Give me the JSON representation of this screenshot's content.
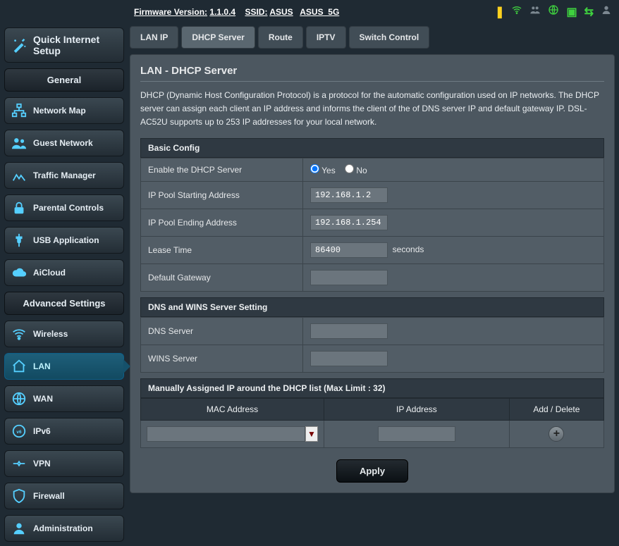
{
  "header": {
    "firmware_label": "Firmware Version:",
    "firmware_value": "1.1.0.4",
    "ssid_label": "SSID:",
    "ssid1": "ASUS",
    "ssid2": "ASUS_5G"
  },
  "sidebar": {
    "quick": "Quick Internet Setup",
    "general_header": "General",
    "general": [
      {
        "label": "Network Map"
      },
      {
        "label": "Guest Network"
      },
      {
        "label": "Traffic Manager"
      },
      {
        "label": "Parental Controls"
      },
      {
        "label": "USB Application"
      },
      {
        "label": "AiCloud"
      }
    ],
    "advanced_header": "Advanced Settings",
    "advanced": [
      {
        "label": "Wireless"
      },
      {
        "label": "LAN"
      },
      {
        "label": "WAN"
      },
      {
        "label": "IPv6"
      },
      {
        "label": "VPN"
      },
      {
        "label": "Firewall"
      },
      {
        "label": "Administration"
      }
    ]
  },
  "tabs": [
    "LAN IP",
    "DHCP Server",
    "Route",
    "IPTV",
    "Switch Control"
  ],
  "page": {
    "title": "LAN - DHCP Server",
    "desc": "DHCP (Dynamic Host Configuration Protocol) is a protocol for the automatic configuration used on IP networks. The DHCP server can assign each client an IP address and informs the client of the of DNS server IP and default gateway IP. DSL-AC52U supports up to 253 IP addresses for your local network."
  },
  "basic": {
    "section": "Basic Config",
    "enable_label": "Enable the DHCP Server",
    "yes": "Yes",
    "no": "No",
    "ip_start_label": "IP Pool Starting Address",
    "ip_start_value": "192.168.1.2",
    "ip_end_label": "IP Pool Ending Address",
    "ip_end_value": "192.168.1.254",
    "lease_label": "Lease Time",
    "lease_value": "86400",
    "lease_unit": "seconds",
    "gateway_label": "Default Gateway",
    "gateway_value": ""
  },
  "dns": {
    "section": "DNS and WINS Server Setting",
    "dns_label": "DNS Server",
    "dns_value": "",
    "wins_label": "WINS Server",
    "wins_value": ""
  },
  "manual": {
    "section": "Manually Assigned IP around the DHCP list (Max Limit : 32)",
    "col_mac": "MAC Address",
    "col_ip": "IP Address",
    "col_action": "Add / Delete",
    "mac_value": "",
    "ip_value": ""
  },
  "apply": "Apply"
}
